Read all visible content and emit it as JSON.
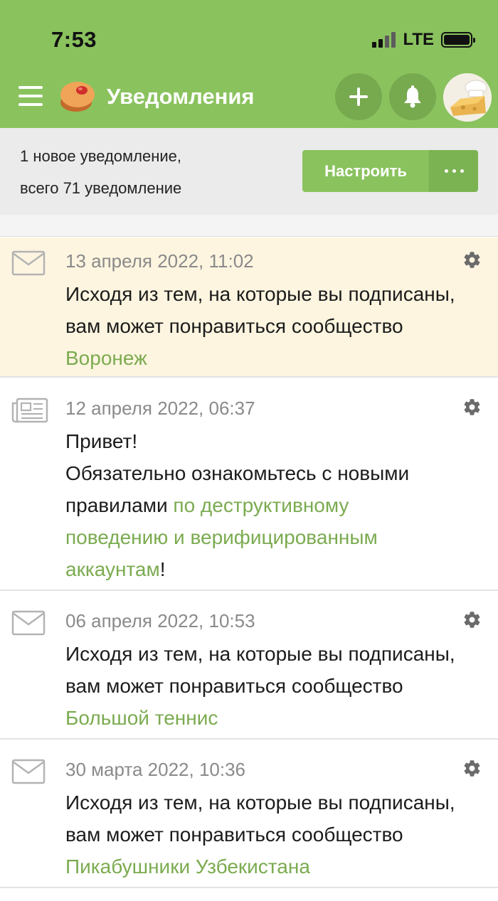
{
  "status_bar": {
    "time": "7:53",
    "network": "LTE"
  },
  "header": {
    "title": "Уведомления"
  },
  "summary": {
    "line1": "1 новое уведомление,",
    "line2": "всего 71 уведомление",
    "setup_button": "Настроить"
  },
  "colors": {
    "brand_green": "#8ac25e",
    "link_green": "#7bab50",
    "unread_bg": "#fdf5e0"
  },
  "notifications": [
    {
      "icon": "envelope-icon",
      "date": "13 апреля 2022, 11:02",
      "line1": "Исходя из тем, на которые вы подписаны,",
      "line2": "вам может понравиться сообщество",
      "link": "Воронеж",
      "unread": true
    },
    {
      "icon": "newspaper-icon",
      "date": "12 апреля 2022, 06:37",
      "greeting": "Привет!",
      "line1": "Обязательно ознакомьтесь с новыми",
      "line2_prefix": "правилами",
      "link_part1": "по деструктивному",
      "link_part2": "поведению и верифицированным",
      "link_part3": "аккаунтам",
      "suffix": "!",
      "unread": false
    },
    {
      "icon": "envelope-icon",
      "date": "06 апреля 2022, 10:53",
      "line1": "Исходя из тем, на которые вы подписаны,",
      "line2": "вам может понравиться сообщество",
      "link": "Большой теннис",
      "unread": false
    },
    {
      "icon": "envelope-icon",
      "date": "30 марта 2022, 10:36",
      "line1": "Исходя из тем, на которые вы подписаны,",
      "line2": "вам может понравиться сообщество",
      "link": "Пикабушники Узбекистана",
      "unread": false
    }
  ]
}
